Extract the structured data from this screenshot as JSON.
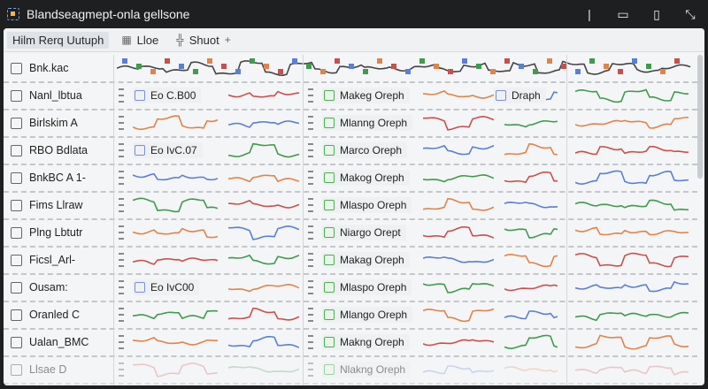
{
  "app": {
    "title": "Blandseagmept-onla gellsone"
  },
  "toolbar": {
    "items": [
      {
        "label": "Hilm Rerq Uutuph",
        "icon": ""
      },
      {
        "label": "Lloe",
        "icon": "panel-icon"
      },
      {
        "label": "Shuot",
        "icon": "column-icon"
      }
    ]
  },
  "colors": {
    "blue": "#5a7fd6",
    "green": "#3e9b4f",
    "orange": "#e0834a",
    "red": "#c94f4f",
    "gray": "#9ea3a8"
  },
  "rows": [
    {
      "label": "Bnk.kac"
    },
    {
      "label": "Nanl_lbtua",
      "chip_left": "Eo C.B00",
      "chip_mid": "Makeg Oreph",
      "chip_right": "Draph"
    },
    {
      "label": "Birlskim A",
      "chip_mid": "Mlanng Oreph"
    },
    {
      "label": "RBO Bdlata",
      "chip_left": "Eo IvC.07",
      "chip_mid": "Marco Oreph"
    },
    {
      "label": "BnkBC A 1-",
      "chip_mid": "Makog Oreph"
    },
    {
      "label": "Fims Llraw",
      "chip_mid": "Mlaspo Oreph"
    },
    {
      "label": "Plng Lbtutr",
      "chip_mid": "Niargo Orept"
    },
    {
      "label": "Ficsl_Arl-",
      "chip_mid": "Makag Oreph"
    },
    {
      "label": "Ousam:",
      "chip_left": "Eo IvC00",
      "chip_mid": "Mlaspo Oreph"
    },
    {
      "label": "Oranled C",
      "chip_mid": "Mlango Oreph"
    },
    {
      "label": "Ualan_BMC",
      "chip_mid": "Makng Oreph"
    },
    {
      "label": "Llsae D",
      "chip_mid": "Nlakng Oreph"
    }
  ]
}
